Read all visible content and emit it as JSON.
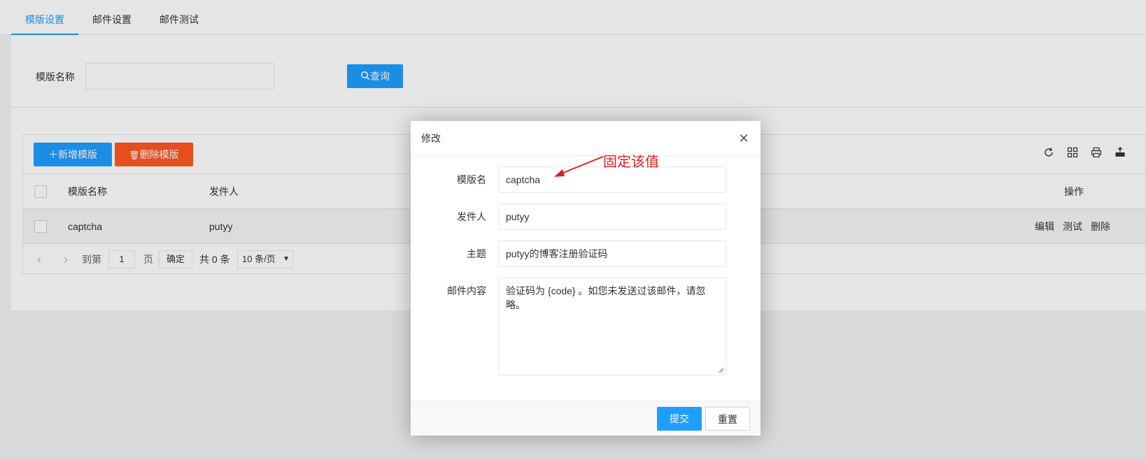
{
  "tabs": [
    {
      "label": "模版设置",
      "active": true
    },
    {
      "label": "邮件设置",
      "active": false
    },
    {
      "label": "邮件测试",
      "active": false
    }
  ],
  "search": {
    "label": "模版名称",
    "value": "",
    "button_label": "查询"
  },
  "toolbar": {
    "add_label": "新增模版",
    "delete_label": "删除模版",
    "icons": [
      "refresh-icon",
      "columns-icon",
      "print-icon",
      "export-icon"
    ]
  },
  "table": {
    "columns": [
      "模版名称",
      "发件人",
      "操作"
    ],
    "rows": [
      {
        "name": "captcha",
        "sender": "putyy",
        "actions": [
          "编辑",
          "测试",
          "删除"
        ]
      }
    ]
  },
  "pager": {
    "goto_label": "到第",
    "page_value": "1",
    "page_unit": "页",
    "confirm_label": "确定",
    "total_label": "共 0 条",
    "page_size": "10 条/页"
  },
  "modal": {
    "title": "修改",
    "fields": [
      {
        "label": "模版名",
        "value": "captcha"
      },
      {
        "label": "发件人",
        "value": "putyy"
      },
      {
        "label": "主题",
        "value": "putyy的博客注册验证码"
      }
    ],
    "content_label": "邮件内容",
    "content_value": "验证码为 {code} 。如您未发送过该邮件，请忽略。",
    "submit_label": "提交",
    "reset_label": "重置"
  },
  "annotation": {
    "text": "固定该值",
    "color": "#e02020"
  },
  "colors": {
    "primary": "#1e9fff",
    "danger": "#ff5722"
  }
}
